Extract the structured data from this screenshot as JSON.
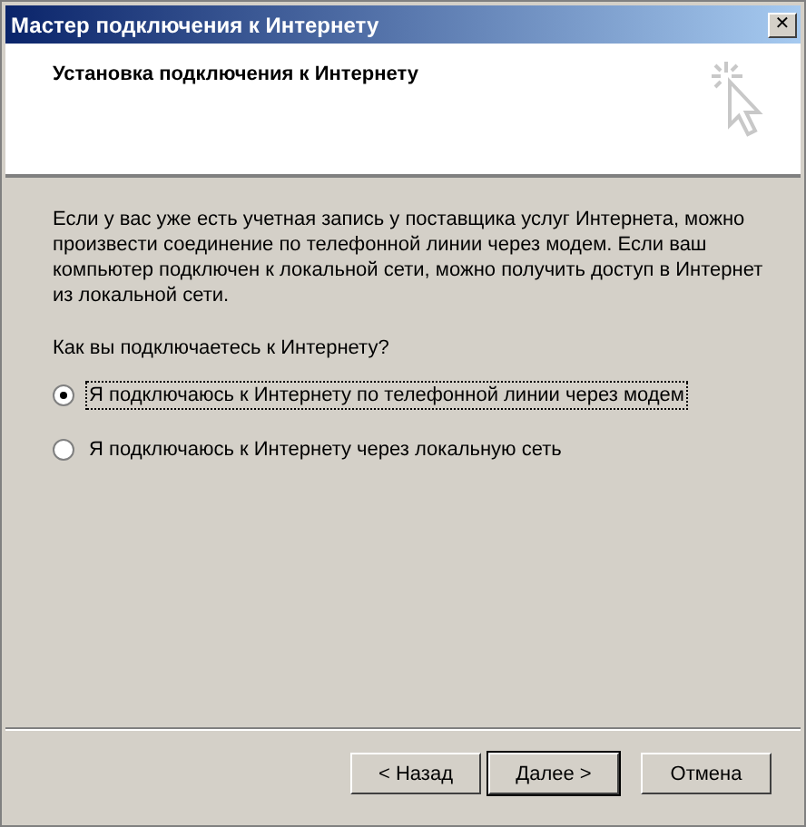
{
  "window": {
    "title": "Мастер подключения к Интернету",
    "close": "✕"
  },
  "header": {
    "title": "Установка подключения к Интернету"
  },
  "body": {
    "description": "Если у вас уже есть учетная запись у поставщика услуг Интернета, можно произвести соединение по телефонной линии через модем. Если ваш компьютер подключен к локальной сети, можно получить доступ в Интернет из локальной сети.",
    "question": "Как вы подключаетесь к Интернету?",
    "options": [
      {
        "label": "Я подключаюсь к Интернету по телефонной линии через модем",
        "selected": true
      },
      {
        "label": "Я подключаюсь к Интернету через локальную сеть",
        "selected": false
      }
    ]
  },
  "buttons": [
    {
      "label": "< Назад",
      "default": false
    },
    {
      "label": "Далее >",
      "default": true
    },
    {
      "label": "Отмена",
      "default": false
    }
  ]
}
